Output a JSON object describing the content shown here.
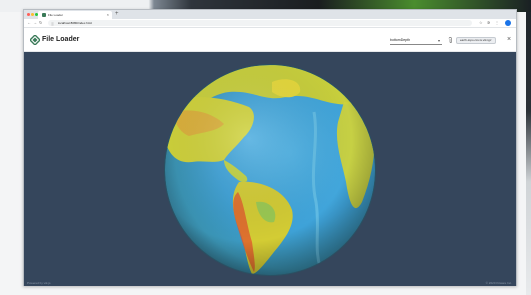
{
  "browser": {
    "tab_title": "File Loader",
    "tab_close": "×",
    "new_tab": "+",
    "url": "localhost:8080/index.html",
    "lock": "ⓘ",
    "back": "←",
    "forward": "→",
    "reload": "↻"
  },
  "app": {
    "title": "File Loader",
    "attribute_select": {
      "value": "bottomDepth",
      "caret": "▾"
    },
    "url_input": {
      "value": "earth-topo.csv.ts.vtk.tgz"
    },
    "close": "×"
  },
  "footer": {
    "left": "Powered by vtk.js",
    "right": "© 2020 Kitware Inc."
  },
  "colors": {
    "background": "#35465c",
    "accent": "#3a7a58"
  }
}
